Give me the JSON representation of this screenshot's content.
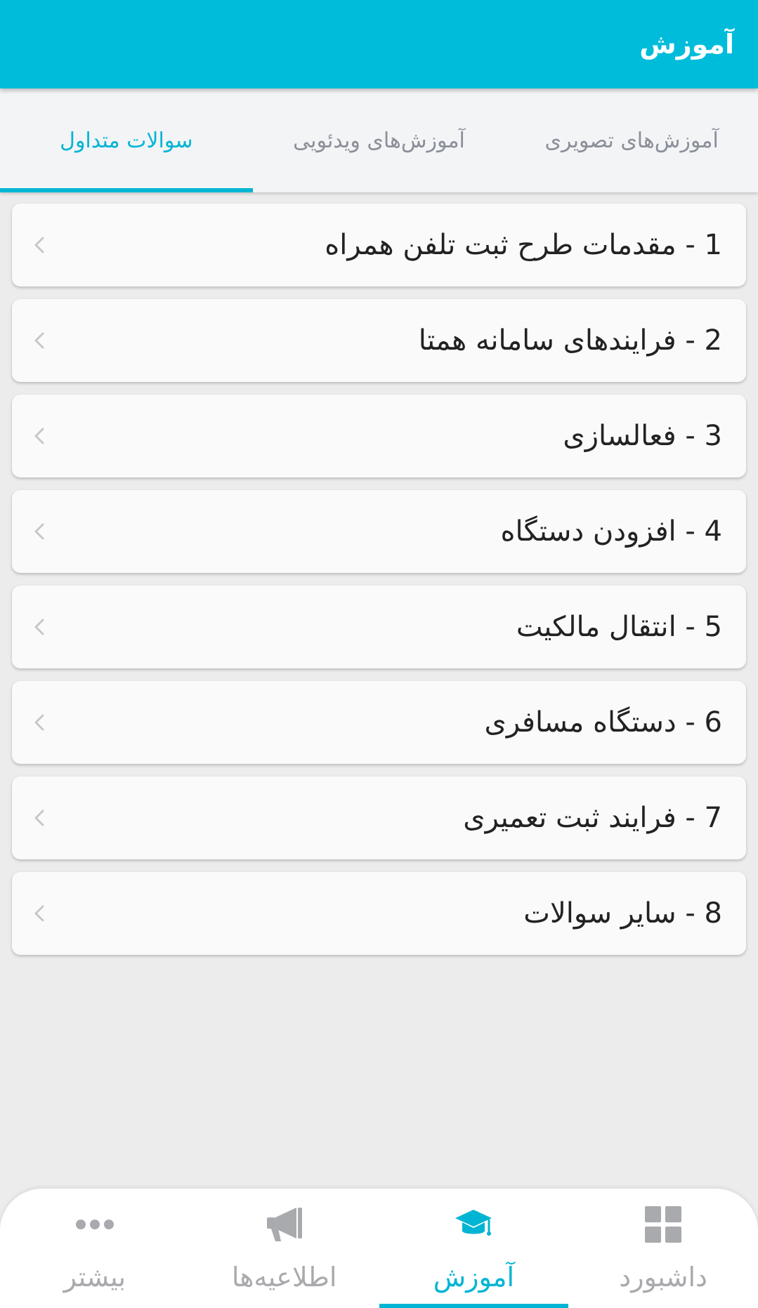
{
  "header": {
    "title": "آموزش"
  },
  "tabs": [
    {
      "label": "آموزش‌های تصویری"
    },
    {
      "label": "آموزش‌های ویدئویی"
    },
    {
      "label": "سوالات متداول"
    }
  ],
  "active_tab": "سوالات متداول",
  "faq_items": [
    {
      "label": "1 - مقدمات طرح ثبت تلفن همراه"
    },
    {
      "label": "2 - فرایندهای سامانه همتا"
    },
    {
      "label": "3 - فعالسازی"
    },
    {
      "label": "4 - افزودن دستگاه"
    },
    {
      "label": "5 - انتقال مالکیت"
    },
    {
      "label": "6 - دستگاه مسافری"
    },
    {
      "label": "7 - فرایند ثبت تعمیری"
    },
    {
      "label": "8 - سایر سوالات"
    }
  ],
  "bottom_nav": [
    {
      "label": "داشبورد",
      "icon": "dashboard-grid-icon"
    },
    {
      "label": "آموزش",
      "icon": "graduation-cap-icon"
    },
    {
      "label": "اطلاعیه‌ها",
      "icon": "megaphone-icon"
    },
    {
      "label": "بیشتر",
      "icon": "more-dots-icon"
    }
  ],
  "active_nav": "آموزش",
  "colors": {
    "primary": "#00bcdb",
    "accent": "#00b5d3",
    "inactive": "#a9aaad",
    "background": "#ececec"
  }
}
